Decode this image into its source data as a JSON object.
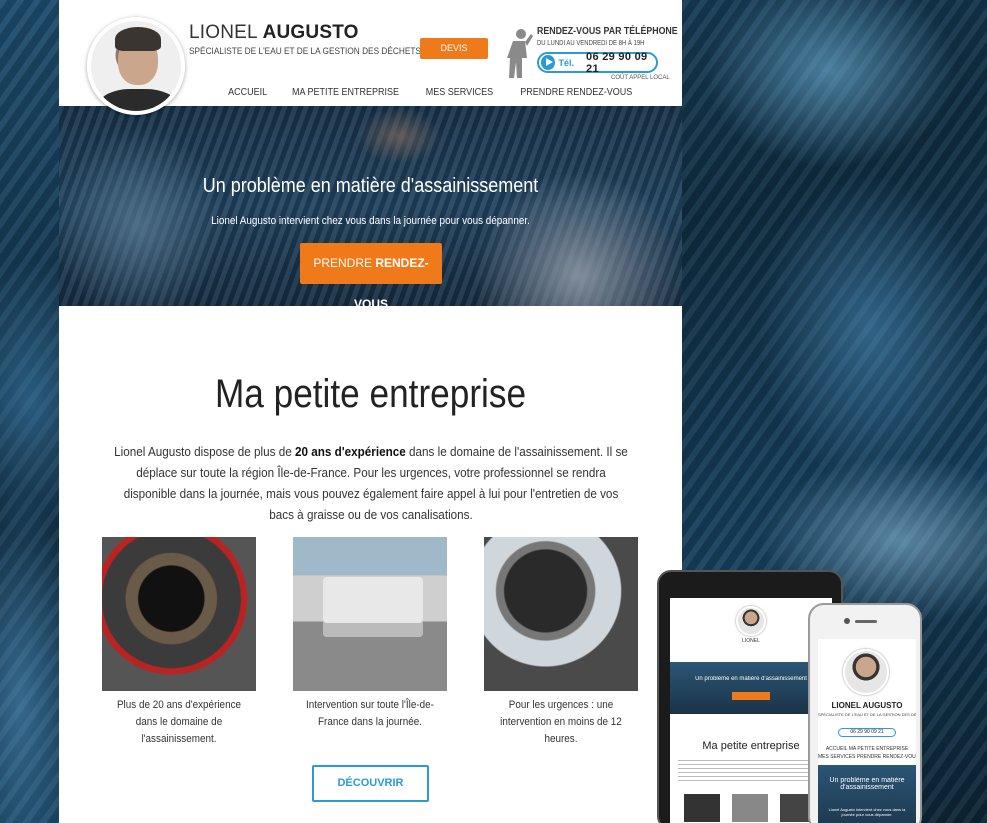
{
  "header": {
    "first_name": "LIONEL",
    "last_name": "AUGUSTO",
    "tagline": "SPÉCIALISTE DE L'EAU ET DE LA GESTION DES DÉCHETS",
    "cta_label": "DEVIS GRATUIT",
    "rdv_title": "RENDEZ-VOUS PAR TÉLÉPHONE",
    "rdv_hours": "DU LUNDI AU VENDREDI DE 8H À 19H",
    "tel_label": "Tél.",
    "phone": "06 29 90 09 21",
    "cost_note": "COÛT APPEL LOCAL"
  },
  "nav": {
    "items": [
      "ACCUEIL",
      "MA PETITE ENTREPRISE",
      "MES SERVICES",
      "PRENDRE RENDEZ-VOUS"
    ]
  },
  "hero": {
    "title": "Un problème en matière d'assainissement",
    "subtitle": "Lionel Augusto intervient chez vous dans la journée pour vous dépanner.",
    "button_prefix": "PRENDRE",
    "button_strong": "RENDEZ-VOUS"
  },
  "section": {
    "title": "Ma petite entreprise",
    "text_before": "Lionel Augusto dispose de plus de ",
    "text_bold": "20 ans d'expérience",
    "text_after": " dans le domaine de l'assainissement. Il se déplace sur toute la région Île-de-France. Pour les urgences, votre professionnel se rendra disponible dans la journée, mais vous pouvez également faire appel à lui pour l'entretien de vos bacs à graisse ou de vos canalisations.",
    "cards": [
      {
        "caption": "Plus de 20 ans d'expérience dans le domaine de l'assainissement."
      },
      {
        "caption": "Intervention sur toute l'Île-de-France dans la journée."
      },
      {
        "caption": "Pour les urgences : une intervention en moins de 12 heures."
      }
    ],
    "button_label": "DÉCOUVRIR"
  },
  "mobile_preview": {
    "name_first": "LIONEL",
    "name_last": "AUGUSTO",
    "tagline": "SPÉCIALISTE DE L'EAU ET DE LA GESTION DES DÉCHETS",
    "phone": "06 29 90 09 21",
    "nav_line1": "ACCUEIL    MA PETITE ENTREPRISE",
    "nav_line2": "MES SERVICES    PRENDRE RENDEZ-VOUS",
    "hero_title": "Un problème en matière d'assainissement",
    "hero_sub": "Lionel Augusto intervient chez vous dans la journée pour vous dépanner."
  },
  "tablet_preview": {
    "section_title": "Ma petite entreprise",
    "hero_title": "Un problème en matière d'assainissement"
  },
  "colors": {
    "accent_orange": "#f07a1a",
    "accent_blue": "#2a9bd6"
  }
}
